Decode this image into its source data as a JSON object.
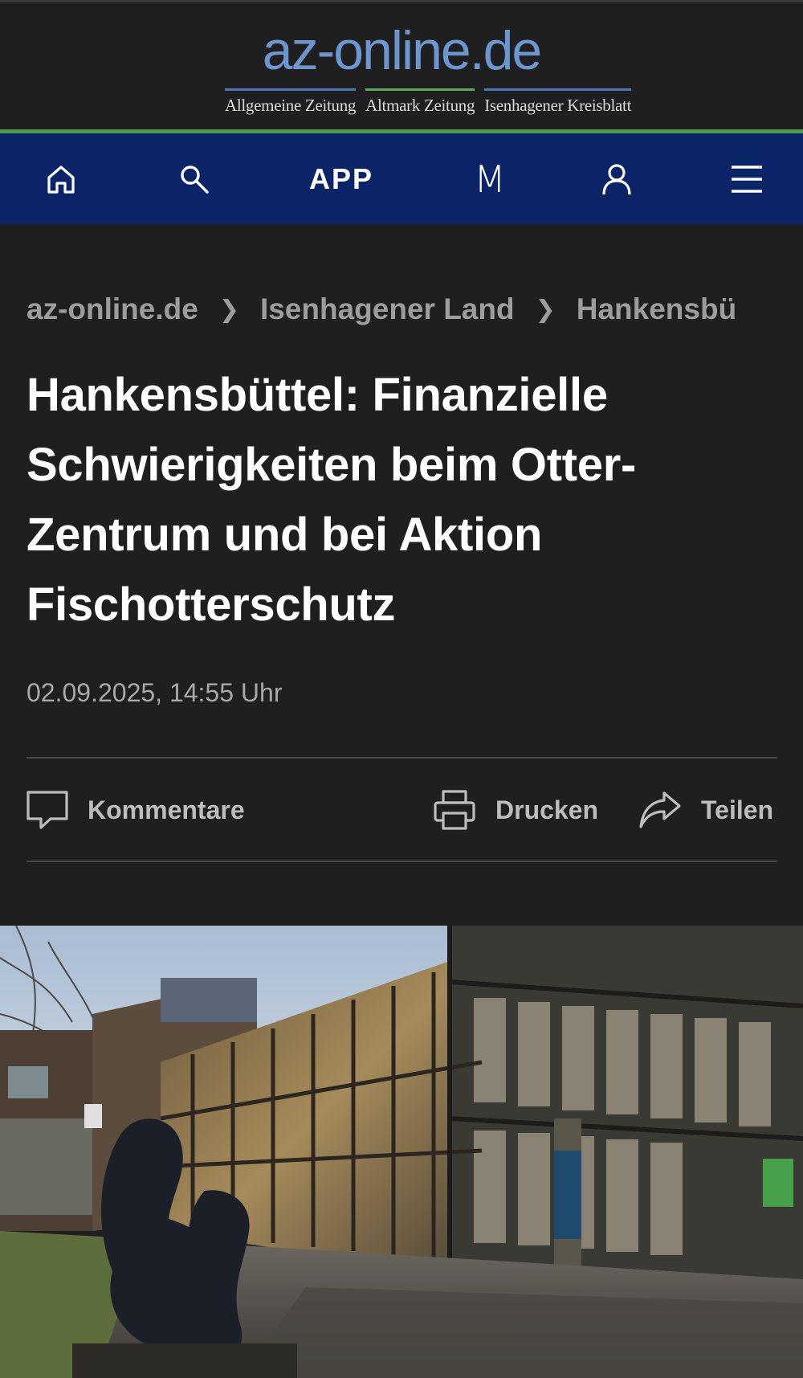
{
  "masthead": {
    "logo": "az-online.de",
    "papers": [
      "Allgemeine Zeitung",
      "Altmark Zeitung",
      "Isenhagener Kreisblatt"
    ]
  },
  "nav": {
    "home_icon": "home-icon",
    "search_icon": "search-icon",
    "app_label": "APP",
    "m_label": "M",
    "account_icon": "user-icon",
    "menu_icon": "hamburger-menu-icon"
  },
  "breadcrumb": {
    "items": [
      "az-online.de",
      "Isenhagener Land",
      "Hankensbü"
    ],
    "separator": "❯"
  },
  "article": {
    "title": "Hankensbüttel: Finanzielle Schwierigkeiten beim Otter-Zentrum und bei Aktion Fischotterschutz",
    "timestamp": "02.09.2025, 14:55 Uhr"
  },
  "actions": {
    "comments": "Kommentare",
    "print": "Drucken",
    "share": "Teilen"
  },
  "colors": {
    "background": "#1f1f1f",
    "nav_background": "#0b2468",
    "logo_blue": "#6b96cf",
    "accent_green": "#4f9a48"
  }
}
